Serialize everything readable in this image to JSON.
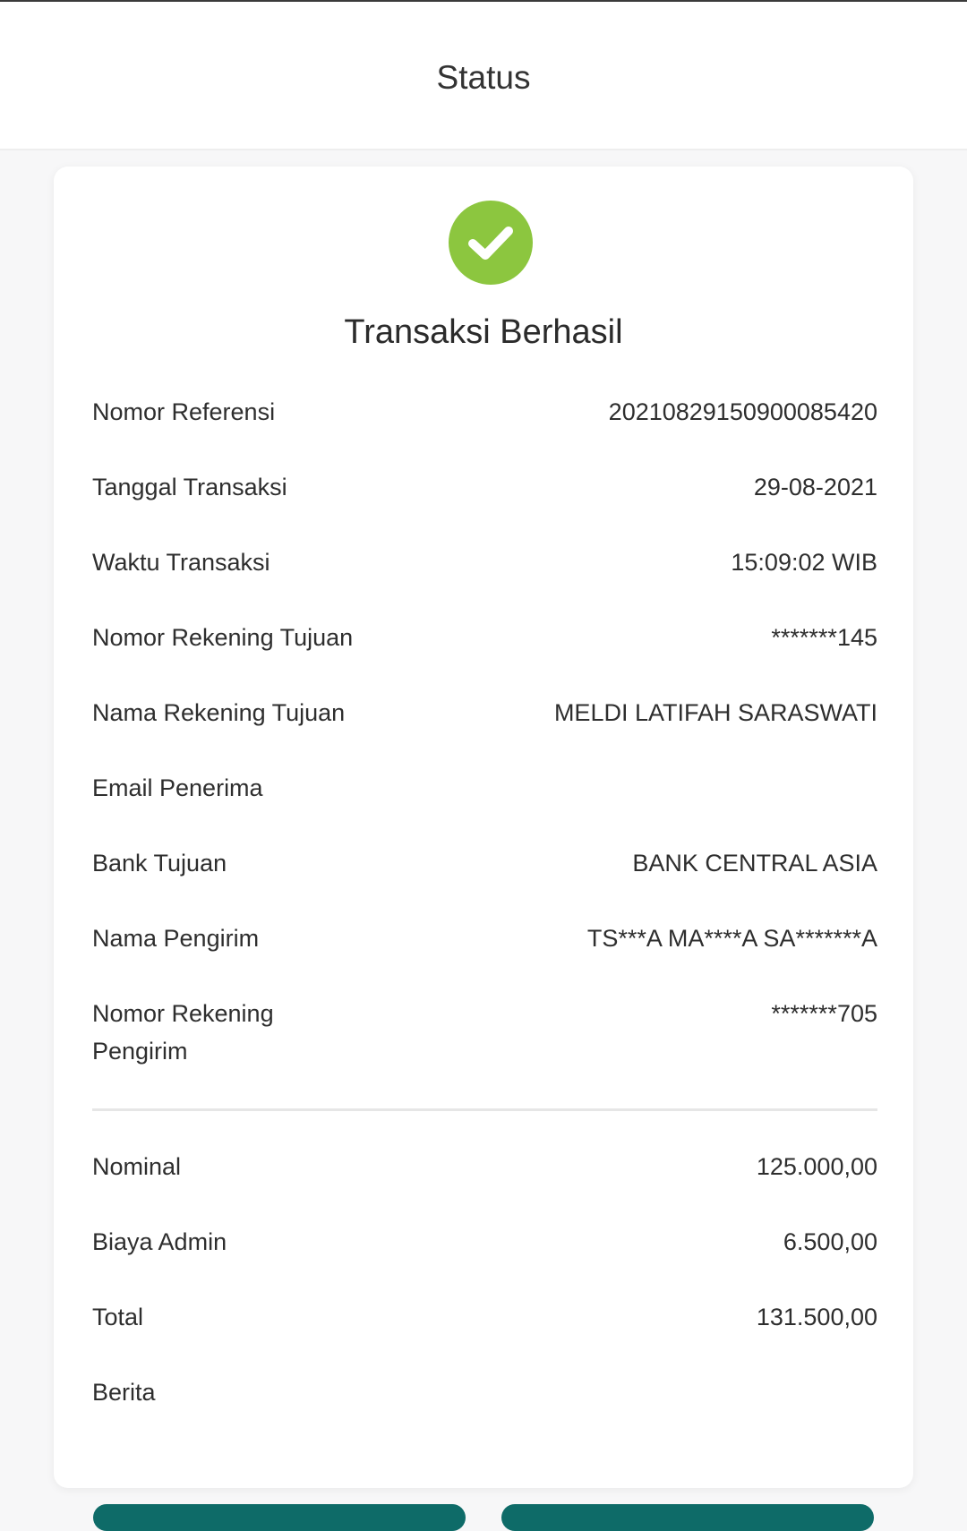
{
  "header": {
    "title": "Status"
  },
  "status": {
    "title": "Transaksi Berhasil",
    "icon": "check-circle-icon",
    "icon_color": "#8cc63f"
  },
  "details": [
    {
      "label": "Nomor Referensi",
      "value": "20210829150900085420"
    },
    {
      "label": "Tanggal Transaksi",
      "value": "29-08-2021"
    },
    {
      "label": "Waktu Transaksi",
      "value": "15:09:02 WIB"
    },
    {
      "label": "Nomor Rekening Tujuan",
      "value": "*******145"
    },
    {
      "label": "Nama Rekening Tujuan",
      "value": "MELDI LATIFAH SARASWATI"
    },
    {
      "label": "Email Penerima",
      "value": ""
    },
    {
      "label": "Bank Tujuan",
      "value": "BANK CENTRAL ASIA"
    },
    {
      "label": "Nama Pengirim",
      "value": "TS***A MA****A SA*******A"
    },
    {
      "label": "Nomor Rekening\nPengirim",
      "value": "*******705"
    }
  ],
  "amounts": [
    {
      "label": "Nominal",
      "value": "125.000,00"
    },
    {
      "label": "Biaya Admin",
      "value": "6.500,00"
    },
    {
      "label": "Total",
      "value": "131.500,00"
    },
    {
      "label": "Berita",
      "value": ""
    }
  ],
  "colors": {
    "accent": "#0e6b68",
    "success": "#8cc63f"
  }
}
